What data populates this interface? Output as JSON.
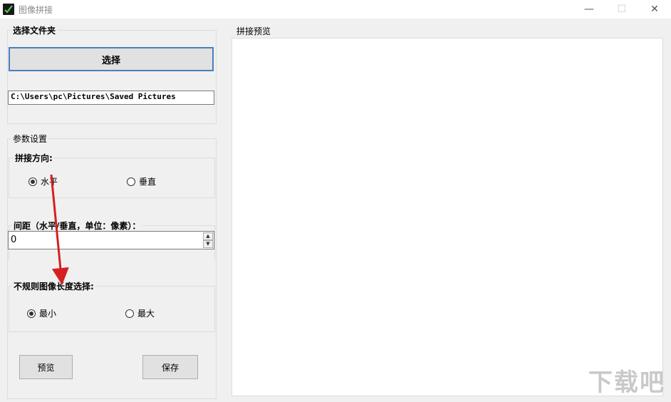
{
  "window": {
    "title": "图像拼接",
    "minimize": "—",
    "maximize": "☐",
    "close": "✕"
  },
  "folder_section": {
    "label": "选择文件夹",
    "select_button": "选择",
    "path_value": "C:\\Users\\pc\\Pictures\\Saved Pictures"
  },
  "params": {
    "label": "参数设置",
    "direction": {
      "label": "拼接方向:",
      "options": [
        {
          "label": "水平",
          "checked": true
        },
        {
          "label": "垂直",
          "checked": false
        }
      ]
    },
    "spacing": {
      "label": "间距（水平/垂直，单位：像素）：",
      "value": "0"
    },
    "irregular": {
      "label": "不规则图像长度选择:",
      "options": [
        {
          "label": "最小",
          "checked": true
        },
        {
          "label": "最大",
          "checked": false
        }
      ]
    }
  },
  "actions": {
    "preview_button": "预览",
    "save_button": "保存"
  },
  "preview_panel": {
    "label": "拼接预览"
  },
  "annotation": {
    "arrow_color": "#d42020"
  },
  "watermark": {
    "text": "下载吧"
  }
}
